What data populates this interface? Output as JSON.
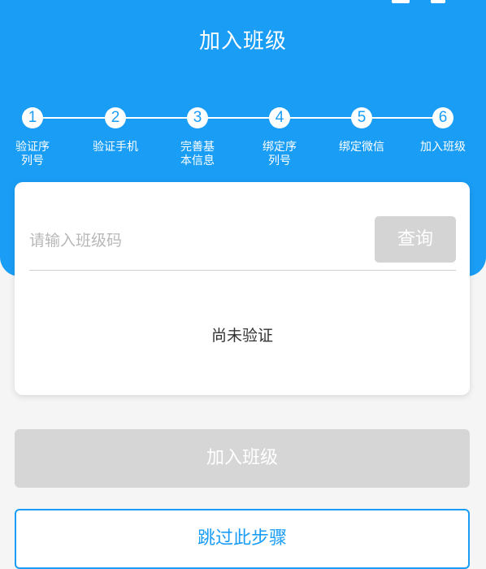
{
  "header": {
    "title": "加入班级",
    "accent": "#1a9df5"
  },
  "steps": [
    {
      "num": "1",
      "label": "验证序\n列号"
    },
    {
      "num": "2",
      "label": "验证手机"
    },
    {
      "num": "3",
      "label": "完善基\n本信息"
    },
    {
      "num": "4",
      "label": "绑定序\n列号"
    },
    {
      "num": "5",
      "label": "绑定微信"
    },
    {
      "num": "6",
      "label": "加入班级"
    }
  ],
  "card": {
    "input_placeholder": "请输入班级码",
    "input_value": "",
    "query_label": "查询",
    "status": "尚未验证"
  },
  "actions": {
    "join_label": "加入班级",
    "skip_label": "跳过此步骤"
  }
}
